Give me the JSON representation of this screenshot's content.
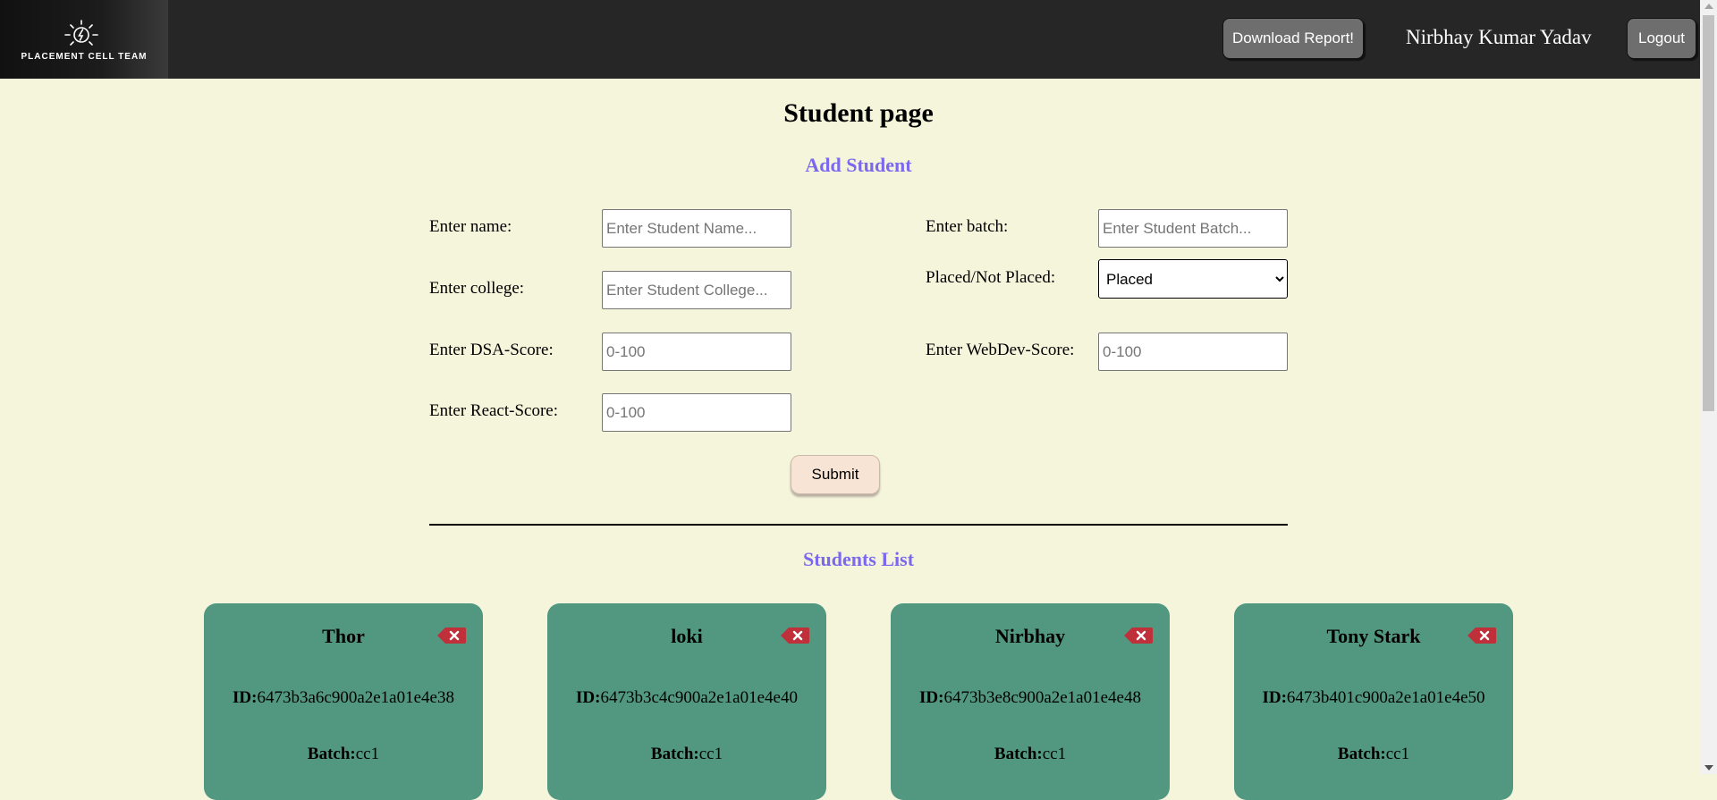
{
  "navbar": {
    "logo_text": "PLACEMENT CELL TEAM",
    "download_label": "Download Report!",
    "username": "Nirbhay Kumar Yadav",
    "logout_label": "Logout"
  },
  "page_title": "Student page",
  "add_section_title": "Add Student",
  "form": {
    "name_label": "Enter name:",
    "name_placeholder": "Enter Student Name...",
    "college_label": "Enter college:",
    "college_placeholder": "Enter Student College...",
    "dsa_label": "Enter DSA-Score:",
    "dsa_placeholder": "0-100",
    "react_label": "Enter React-Score:",
    "react_placeholder": "0-100",
    "batch_label": "Enter batch:",
    "batch_placeholder": "Enter Student Batch...",
    "placed_label": "Placed/Not Placed:",
    "placed_selected": "Placed",
    "webdev_label": "Enter WebDev-Score:",
    "webdev_placeholder": "0-100",
    "submit_label": "Submit"
  },
  "list_section_title": "Students List",
  "students": [
    {
      "name": "Thor",
      "id_label": "ID:",
      "id": "6473b3a6c900a2e1a01e4e38",
      "batch_label": "Batch:",
      "batch": "cc1"
    },
    {
      "name": "loki",
      "id_label": "ID:",
      "id": "6473b3c4c900a2e1a01e4e40",
      "batch_label": "Batch:",
      "batch": "cc1"
    },
    {
      "name": "Nirbhay",
      "id_label": "ID:",
      "id": "6473b3e8c900a2e1a01e4e48",
      "batch_label": "Batch:",
      "batch": "cc1"
    },
    {
      "name": "Tony Stark",
      "id_label": "ID:",
      "id": "6473b401c900a2e1a01e4e50",
      "batch_label": "Batch:",
      "batch": "cc1"
    }
  ],
  "colors": {
    "page_bg": "#f5f5dc",
    "navbar_bg": "#262626",
    "accent": "#7b68ee",
    "card_bg": "#529780",
    "delete_icon": "#c0303a"
  },
  "icons": {
    "logo": "lightbulb-icon",
    "delete": "delete-backspace-icon"
  }
}
